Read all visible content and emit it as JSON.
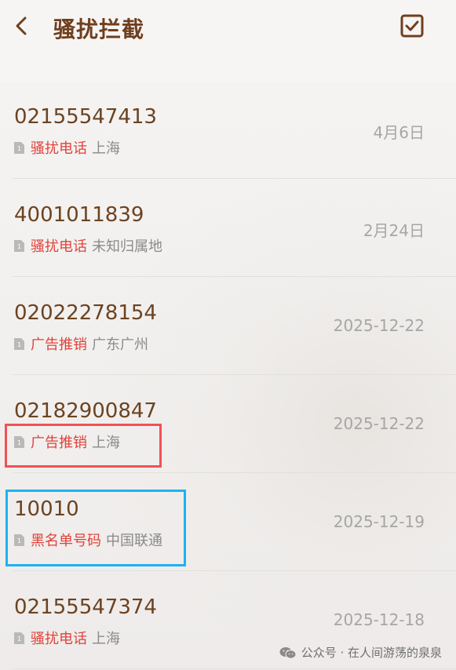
{
  "header": {
    "title": "骚扰拦截",
    "back_icon": "chevron-left-icon",
    "select_icon": "checkbox-checked-icon"
  },
  "calls": [
    {
      "number": "02155547413",
      "tag": "骚扰电话",
      "location": "上海",
      "date": "4月6日"
    },
    {
      "number": "4001011839",
      "tag": "骚扰电话",
      "location": "未知归属地",
      "date": "2月24日"
    },
    {
      "number": "02022278154",
      "tag": "广告推销",
      "location": "广东广州",
      "date": "2025-12-22"
    },
    {
      "number": "02182900847",
      "tag": "广告推销",
      "location": "上海",
      "date": "2025-12-22"
    },
    {
      "number": "10010",
      "tag": "黑名单号码",
      "location": "中国联通",
      "date": "2025-12-19"
    },
    {
      "number": "02155547374",
      "tag": "骚扰电话",
      "location": "上海",
      "date": "2025-12-18"
    }
  ],
  "watermark": {
    "text": "公众号 · 在人间游荡的泉泉",
    "icon": "wechat-icon"
  },
  "colors": {
    "title": "#6f3f1e",
    "number": "#6c4321",
    "tag": "#e0423a",
    "highlight_red": "#ef5255",
    "highlight_blue": "#1eb1f2"
  }
}
